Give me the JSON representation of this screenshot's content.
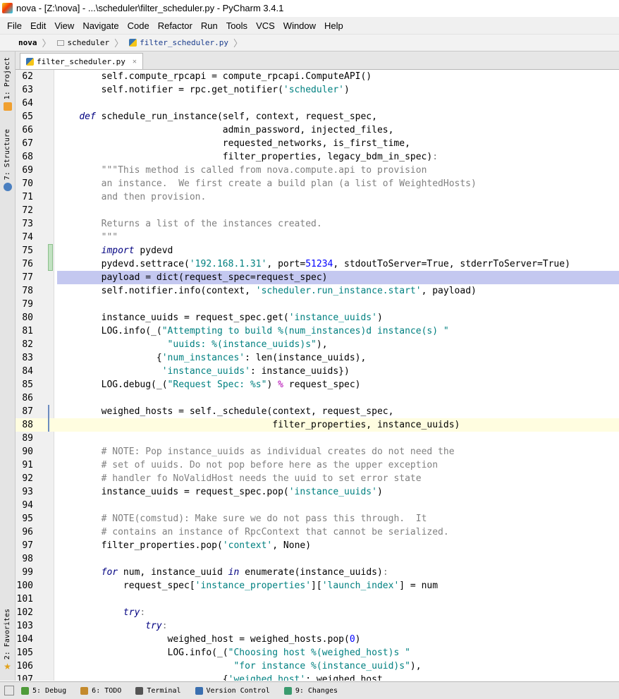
{
  "window": {
    "title": "nova - [Z:\\nova] - ...\\scheduler\\filter_scheduler.py - PyCharm 3.4.1"
  },
  "menu": [
    "File",
    "Edit",
    "View",
    "Navigate",
    "Code",
    "Refactor",
    "Run",
    "Tools",
    "VCS",
    "Window",
    "Help"
  ],
  "breadcrumb": [
    "nova",
    "scheduler",
    "filter_scheduler.py"
  ],
  "tools_left": {
    "project": "1: Project",
    "structure": "7: Structure",
    "favorites": "2: Favorites"
  },
  "editor": {
    "tab_label": "filter_scheduler.py",
    "lines": [
      {
        "n": "62",
        "html": "        self.compute_rpcapi = compute_rpcapi.ComputeAPI()"
      },
      {
        "n": "63",
        "html": "        self.notifier = rpc.get_notifier(<span class='str'>'scheduler'</span>)"
      },
      {
        "n": "64",
        "html": ""
      },
      {
        "n": "65",
        "html": "    <span class='kwi'>def</span> schedule_run_instance(self, context, request_spec,"
      },
      {
        "n": "66",
        "html": "                              admin_password, injected_files,"
      },
      {
        "n": "67",
        "html": "                              requested_networks, is_first_time,"
      },
      {
        "n": "68",
        "html": "                              filter_properties, legacy_bdm_in_spec)<span class='ob'>:</span>"
      },
      {
        "n": "69",
        "html": "        <span class='doc'>\"\"\"This method is called from nova.compute.api to provision</span>"
      },
      {
        "n": "70",
        "html": "        <span class='doc'>an instance.  We first create a build plan (a list of WeightedHosts)</span>"
      },
      {
        "n": "71",
        "html": "        <span class='doc'>and then provision.</span>"
      },
      {
        "n": "72",
        "html": ""
      },
      {
        "n": "73",
        "html": "        <span class='doc'>Returns a list of the instances created.</span>"
      },
      {
        "n": "74",
        "html": "        <span class='doc'>\"\"\"</span>"
      },
      {
        "n": "75",
        "html": "        <span class='kwi'>import</span> pydevd"
      },
      {
        "n": "76",
        "html": "        pydevd.settrace(<span class='str'>'192.168.1.31'</span>, port=<span class='num'>51234</span>, stdoutToServer=True, stderrToServer=True)"
      },
      {
        "n": "77",
        "html": "        payload = dict(request_spec=request_spec)"
      },
      {
        "n": "78",
        "html": "        self.notifier.info(context, <span class='str'>'scheduler.run_instance.start'</span>, payload)"
      },
      {
        "n": "79",
        "html": ""
      },
      {
        "n": "80",
        "html": "        instance_uuids = request_spec.get(<span class='str'>'instance_uuids'</span>)"
      },
      {
        "n": "81",
        "html": "        LOG.info(_(<span class='str'>\"Attempting to build %(num_instances)d instance(s) \"</span>"
      },
      {
        "n": "82",
        "html": "                    <span class='str'>\"uuids: %(instance_uuids)s\"</span>),"
      },
      {
        "n": "83",
        "html": "                  {<span class='str'>'num_instances'</span>: len(instance_uuids),"
      },
      {
        "n": "84",
        "html": "                   <span class='str'>'instance_uuids'</span>: instance_uuids})"
      },
      {
        "n": "85",
        "html": "        LOG.debug(_(<span class='str'>\"Request Spec: %s\"</span>) <span class='mag'>%</span> request_spec)"
      },
      {
        "n": "86",
        "html": ""
      },
      {
        "n": "87",
        "html": "        weighed_hosts = self._schedule(context, request_spec,"
      },
      {
        "n": "88",
        "html": "                                       filter_properties, instance_uuids)"
      },
      {
        "n": "89",
        "html": ""
      },
      {
        "n": "90",
        "html": "        <span class='com'># NOTE: Pop instance_uuids as individual creates do not need the</span>"
      },
      {
        "n": "91",
        "html": "        <span class='com'># set of uuids. Do not pop before here as the upper exception</span>"
      },
      {
        "n": "92",
        "html": "        <span class='com'># handler fo NoValidHost needs the uuid to set error state</span>"
      },
      {
        "n": "93",
        "html": "        instance_uuids = request_spec.pop(<span class='str'>'instance_uuids'</span>)"
      },
      {
        "n": "94",
        "html": ""
      },
      {
        "n": "95",
        "html": "        <span class='com'># NOTE(comstud): Make sure we do not pass this through.  It</span>"
      },
      {
        "n": "96",
        "html": "        <span class='com'># contains an instance of RpcContext that cannot be serialized.</span>"
      },
      {
        "n": "97",
        "html": "        filter_properties.pop(<span class='str'>'context'</span>, None)"
      },
      {
        "n": "98",
        "html": ""
      },
      {
        "n": "99",
        "html": "        <span class='kwi'>for</span> num, instance_uuid <span class='kwi'>in</span> enumerate(instance_uuids)<span class='ob'>:</span>"
      },
      {
        "n": "100",
        "html": "            request_spec[<span class='str'>'instance_properties'</span>][<span class='str'>'launch_index'</span>] = num"
      },
      {
        "n": "101",
        "html": ""
      },
      {
        "n": "102",
        "html": "            <span class='kwi'>try</span><span class='ob'>:</span>"
      },
      {
        "n": "103",
        "html": "                <span class='kwi'>try</span><span class='ob'>:</span>"
      },
      {
        "n": "104",
        "html": "                    weighed_host = weighed_hosts.pop(<span class='num'>0</span>)"
      },
      {
        "n": "105",
        "html": "                    LOG.info(_(<span class='str'>\"Choosing host %(weighed_host)s \"</span>"
      },
      {
        "n": "106",
        "html": "                                <span class='str'>\"for instance %(instance_uuid)s\"</span>),"
      },
      {
        "n": "107",
        "html": "                              {<span class='str'>'weighed_host'</span>: weighed_host,"
      }
    ],
    "breakpoint_line": "77",
    "caret_line": "88"
  },
  "status_tabs": [
    {
      "label": "5: Debug",
      "color": "#4f9b3a"
    },
    {
      "label": "6: TODO",
      "color": "#c48a2c"
    },
    {
      "label": "Terminal",
      "color": "#555555"
    },
    {
      "label": "Version Control",
      "color": "#3a6fb0"
    },
    {
      "label": "9: Changes",
      "color": "#3a9b6f"
    }
  ]
}
